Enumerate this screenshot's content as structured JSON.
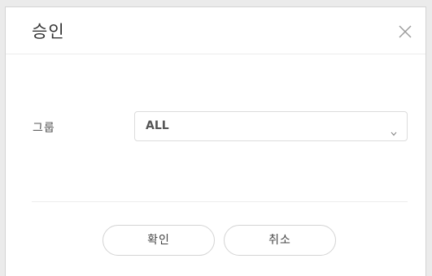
{
  "dialog": {
    "title": "승인",
    "close_icon": "close-icon"
  },
  "form": {
    "group_label": "그룹",
    "group_select": {
      "value": "ALL",
      "icon": "chevron-down-icon"
    }
  },
  "footer": {
    "confirm_label": "확인",
    "cancel_label": "취소"
  },
  "colors": {
    "backdrop": "#ebebeb",
    "dialog_bg": "#ffffff",
    "border": "#d4d4d4",
    "text": "#333333"
  }
}
